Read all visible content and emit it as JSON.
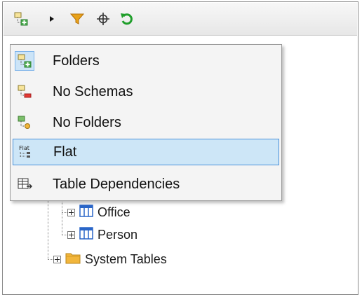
{
  "toolbar": {
    "buttons": [
      {
        "name": "layout-dropdown-button",
        "icon": "folders-layout-icon"
      },
      {
        "name": "dropdown-arrow",
        "icon": "triangle-right-icon"
      },
      {
        "name": "filter-button",
        "icon": "filter-icon"
      },
      {
        "name": "locate-button",
        "icon": "crosshair-icon"
      },
      {
        "name": "refresh-button",
        "icon": "refresh-icon"
      }
    ]
  },
  "menu": {
    "items": [
      {
        "label": "Folders",
        "icon": "folders-icon",
        "checked": true,
        "hover": false
      },
      {
        "label": "No Schemas",
        "icon": "no-schemas-icon",
        "checked": false,
        "hover": false
      },
      {
        "label": "No Folders",
        "icon": "no-folders-icon",
        "checked": false,
        "hover": false
      },
      {
        "label": "Flat",
        "icon": "flat-icon",
        "checked": false,
        "hover": true
      },
      {
        "label": "Table Dependencies",
        "icon": "table-dependencies-icon",
        "checked": false,
        "hover": false
      }
    ]
  },
  "tree": {
    "nodes": [
      {
        "label": "Office",
        "icon": "table-icon"
      },
      {
        "label": "Person",
        "icon": "table-icon"
      },
      {
        "label": "System Tables",
        "icon": "folder-icon"
      }
    ]
  },
  "colors": {
    "filter": "#e8a21a",
    "refresh": "#1f9e2a",
    "table": "#2a66c8",
    "folder": "#f2b63c",
    "hover_border": "#4a90d9"
  }
}
